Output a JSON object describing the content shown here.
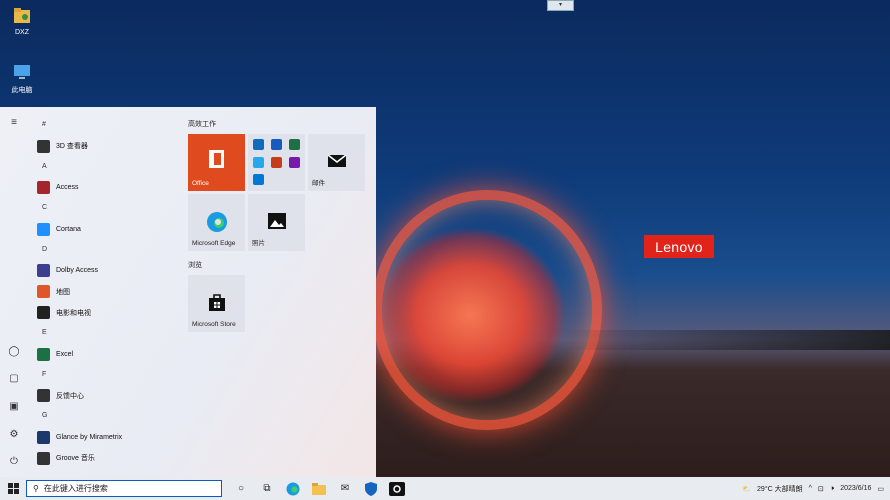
{
  "desktop": {
    "icons": [
      {
        "label": "DXZ",
        "icon": "folder-user-icon"
      },
      {
        "label": "此电脑",
        "icon": "computer-icon"
      }
    ],
    "brand": "Lenovo"
  },
  "start_menu": {
    "rail_icons": [
      "hamburger-icon",
      "user-icon",
      "document-icon",
      "pictures-icon",
      "settings-icon",
      "power-icon"
    ],
    "app_list": [
      {
        "type": "letter",
        "text": "#"
      },
      {
        "type": "app",
        "text": "3D 查看器",
        "color": "#333333"
      },
      {
        "type": "letter",
        "text": "A"
      },
      {
        "type": "app",
        "text": "Access",
        "color": "#a4262c"
      },
      {
        "type": "letter",
        "text": "C"
      },
      {
        "type": "app",
        "text": "Cortana",
        "color": "#1e90ff"
      },
      {
        "type": "letter",
        "text": "D"
      },
      {
        "type": "app",
        "text": "Dolby Access",
        "color": "#3b3f8f"
      },
      {
        "type": "app",
        "text": "地图",
        "color": "#e0562b"
      },
      {
        "type": "app",
        "text": "电影和电视",
        "color": "#222222"
      },
      {
        "type": "letter",
        "text": "E"
      },
      {
        "type": "app",
        "text": "Excel",
        "color": "#1d7044"
      },
      {
        "type": "letter",
        "text": "F"
      },
      {
        "type": "app",
        "text": "反馈中心",
        "color": "#333333"
      },
      {
        "type": "letter",
        "text": "G"
      },
      {
        "type": "app",
        "text": "Glance by Mirametrix",
        "color": "#1b3a6b"
      },
      {
        "type": "app",
        "text": "Groove 音乐",
        "color": "#333333"
      }
    ],
    "groups": {
      "productivity": "高效工作",
      "browse": "浏览"
    },
    "tiles": {
      "office": "Office",
      "mail": "邮件",
      "edge": "Microsoft Edge",
      "photos": "照片",
      "store": "Microsoft Store"
    }
  },
  "taskbar": {
    "search_placeholder": "在此键入进行搜索",
    "weather": "29°C  大部晴朗",
    "date": "2023/6/16"
  },
  "colors": {
    "office_tile": "#e04a1f",
    "lenovo_red": "#e2231a",
    "taskbar": "#e8ebf0",
    "search_border": "#0a5cc2"
  }
}
